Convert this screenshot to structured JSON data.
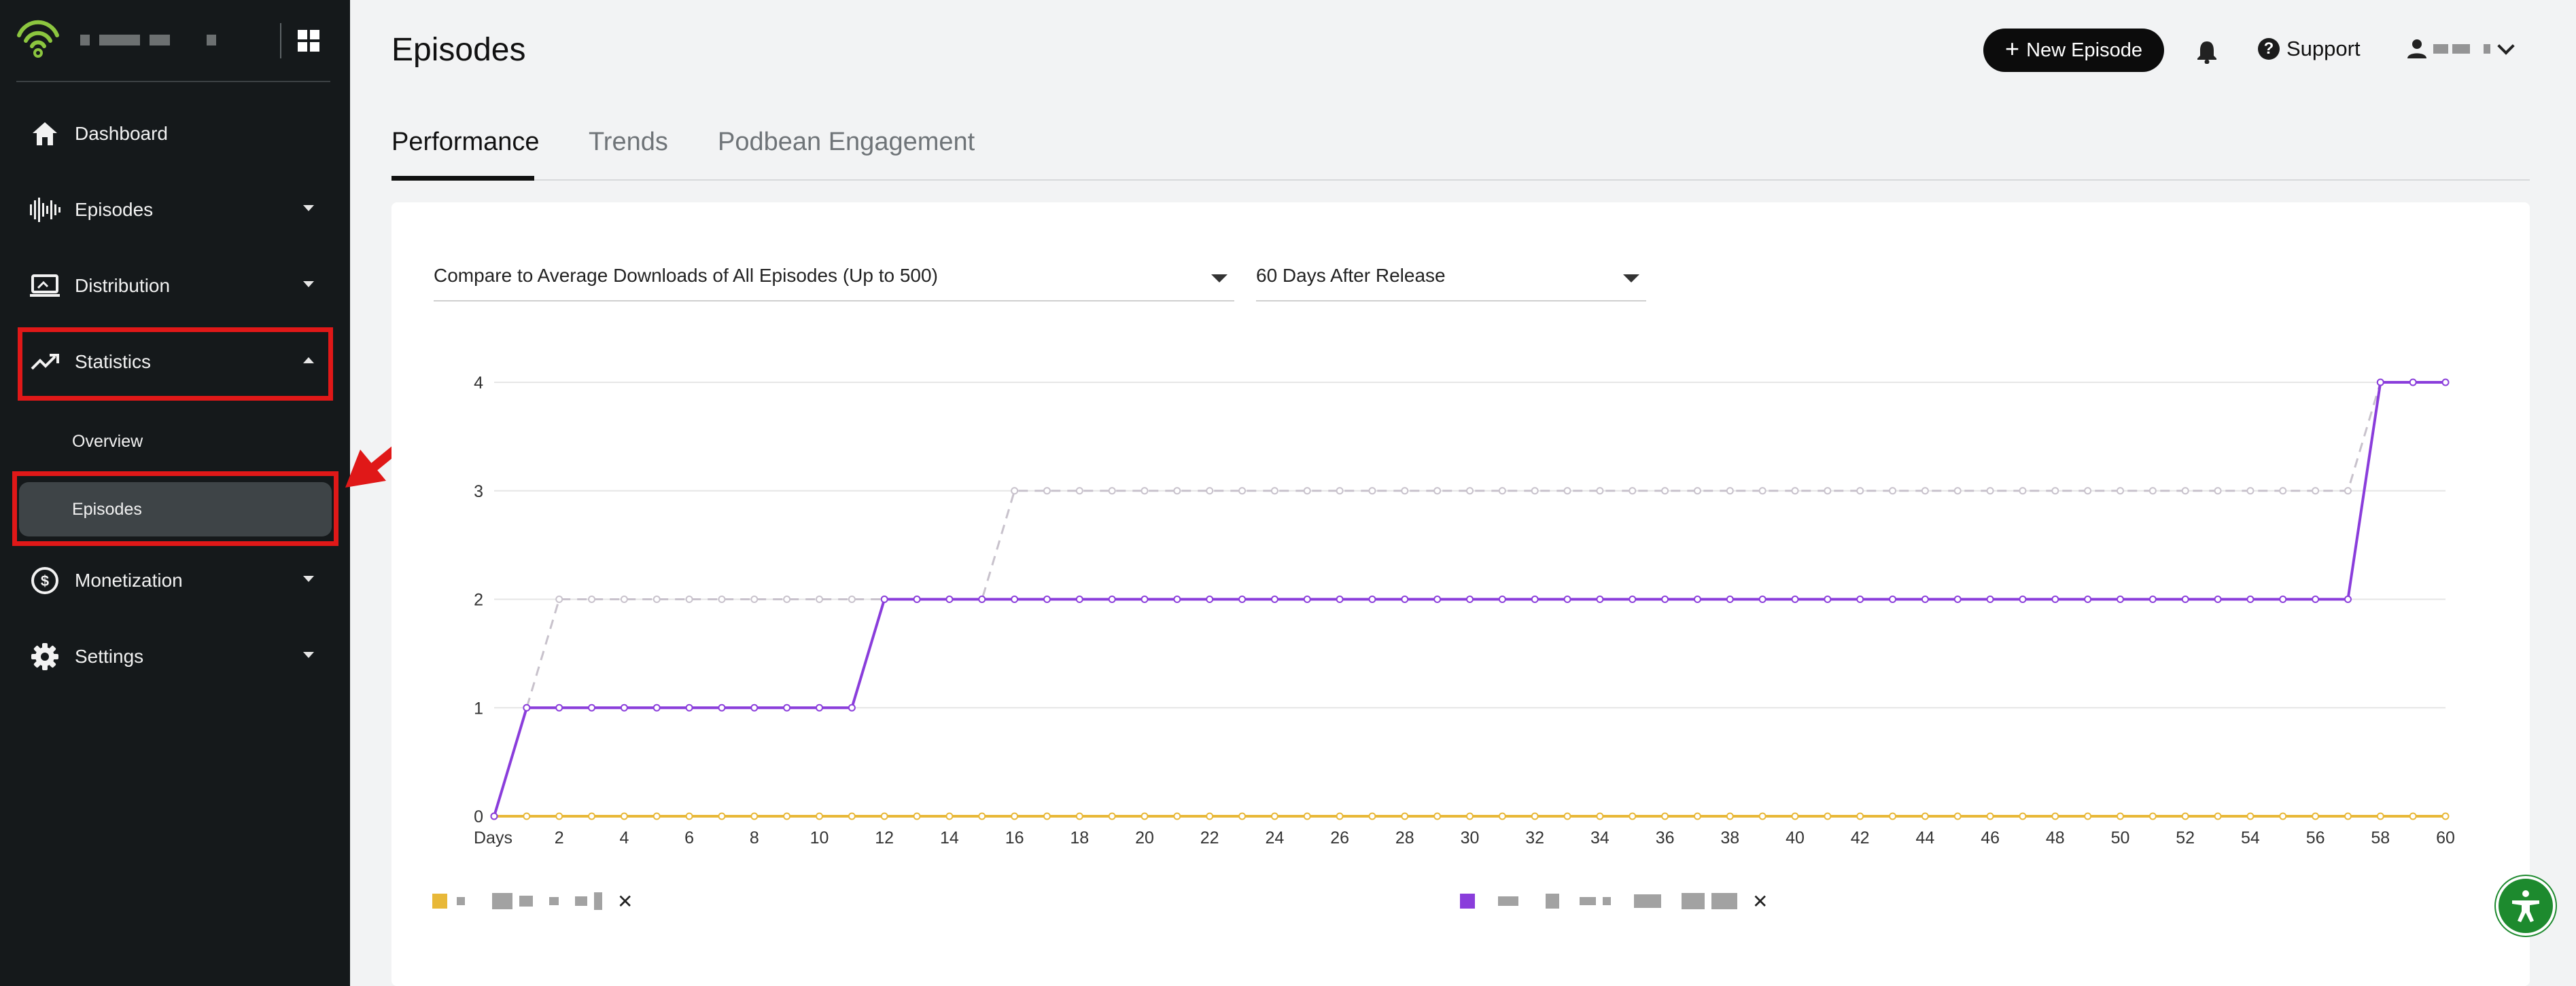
{
  "sidebar": {
    "items": [
      {
        "label": "Dashboard",
        "icon": "home-icon"
      },
      {
        "label": "Episodes",
        "icon": "soundwave-icon"
      },
      {
        "label": "Distribution",
        "icon": "laptop-icon"
      },
      {
        "label": "Statistics",
        "icon": "trending-up-icon"
      },
      {
        "label": "Monetization",
        "icon": "dollar-icon"
      },
      {
        "label": "Settings",
        "icon": "gear-icon"
      }
    ],
    "sub_items": [
      {
        "label": "Overview"
      },
      {
        "label": "Episodes"
      }
    ]
  },
  "header": {
    "title": "Episodes",
    "new_episode_label": "New Episode",
    "support_label": "Support"
  },
  "tabs": [
    {
      "label": "Performance"
    },
    {
      "label": "Trends"
    },
    {
      "label": "Podbean Engagement"
    }
  ],
  "filters": {
    "compare_value": "Compare to Average Downloads of All Episodes (Up to 500)",
    "range_value": "60 Days After Release"
  },
  "colors": {
    "accent_purple": "#8a3ddb",
    "average_dashed": "#c8c2cc",
    "yellow_series": "#e8b838",
    "highlight_red": "#e01818",
    "a11y_green": "#1d8a2e"
  },
  "chart_data": {
    "type": "line",
    "xlabel": "Days",
    "ylim": [
      0,
      4
    ],
    "y_ticks": [
      0,
      1,
      2,
      3,
      4
    ],
    "x_ticks": [
      2,
      4,
      6,
      8,
      10,
      12,
      14,
      16,
      18,
      20,
      22,
      24,
      26,
      28,
      30,
      32,
      34,
      36,
      38,
      40,
      42,
      44,
      46,
      48,
      50,
      52,
      54,
      56,
      58,
      60
    ],
    "grid": true,
    "series": [
      {
        "color": "#e8b838",
        "style": "solid",
        "start_x": 0,
        "values": [
          0,
          0,
          0,
          0,
          0,
          0,
          0,
          0,
          0,
          0,
          0,
          0,
          0,
          0,
          0,
          0,
          0,
          0,
          0,
          0,
          0,
          0,
          0,
          0,
          0,
          0,
          0,
          0,
          0,
          0,
          0,
          0,
          0,
          0,
          0,
          0,
          0,
          0,
          0,
          0,
          0,
          0,
          0,
          0,
          0,
          0,
          0,
          0,
          0,
          0,
          0,
          0,
          0,
          0,
          0,
          0,
          0,
          0,
          0,
          0,
          0
        ]
      },
      {
        "color": "#8a3ddb",
        "style": "solid",
        "start_x": 0,
        "values": [
          0,
          1,
          1,
          1,
          1,
          1,
          1,
          1,
          1,
          1,
          1,
          1,
          2,
          2,
          2,
          2,
          2,
          2,
          2,
          2,
          2,
          2,
          2,
          2,
          2,
          2,
          2,
          2,
          2,
          2,
          2,
          2,
          2,
          2,
          2,
          2,
          2,
          2,
          2,
          2,
          2,
          2,
          2,
          2,
          2,
          2,
          2,
          2,
          2,
          2,
          2,
          2,
          2,
          2,
          2,
          2,
          2,
          2,
          4,
          4,
          4
        ]
      },
      {
        "color": "#c8c2cc",
        "style": "dashed",
        "start_x": 0,
        "values": [
          0,
          1,
          2,
          2,
          2,
          2,
          2,
          2,
          2,
          2,
          2,
          2,
          2,
          2,
          2,
          2,
          3,
          3,
          3,
          3,
          3,
          3,
          3,
          3,
          3,
          3,
          3,
          3,
          3,
          3,
          3,
          3,
          3,
          3,
          3,
          3,
          3,
          3,
          3,
          3,
          3,
          3,
          3,
          3,
          3,
          3,
          3,
          3,
          3,
          3,
          3,
          3,
          3,
          3,
          3,
          3,
          3,
          3,
          4,
          4,
          4
        ]
      }
    ]
  }
}
